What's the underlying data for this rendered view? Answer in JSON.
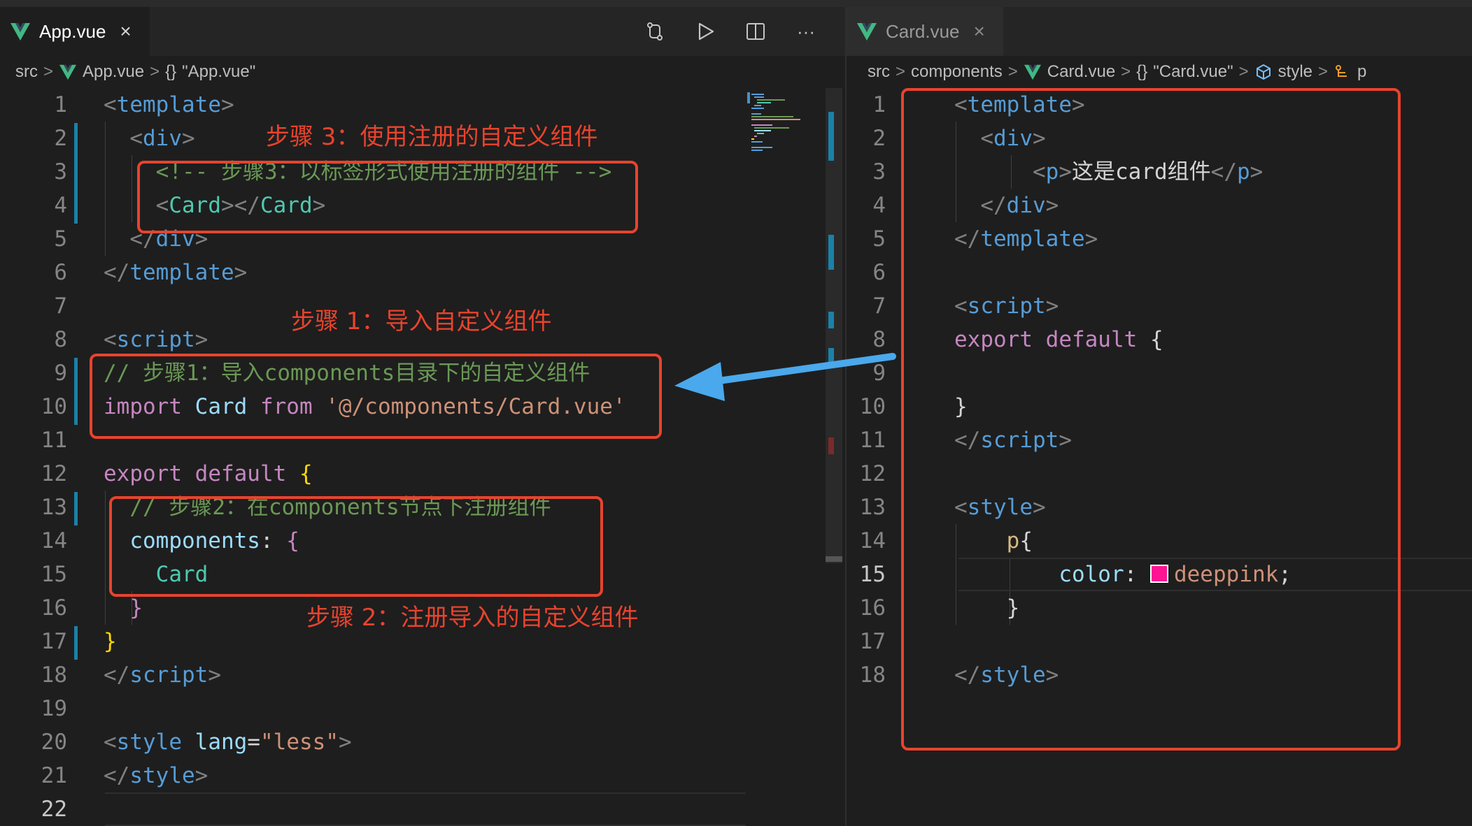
{
  "left": {
    "tab": {
      "label": "App.vue",
      "close": "×"
    },
    "actions": [
      "source-control-icon",
      "run-icon",
      "split-editor-icon",
      "more-icon"
    ],
    "more_label": "···",
    "breadcrumb": {
      "src": "src",
      "file": "App.vue",
      "symbol": "\"App.vue\"",
      "sep": ">",
      "brace": "{}"
    },
    "lines": [
      "1",
      "2",
      "3",
      "4",
      "5",
      "6",
      "7",
      "8",
      "9",
      "10",
      "11",
      "12",
      "13",
      "14",
      "15",
      "16",
      "17",
      "18",
      "19",
      "20",
      "21",
      "22"
    ],
    "code": {
      "l1": "template",
      "l2": "div",
      "l3": "<!-- 步骤3：以标签形式使用注册的组件 -->",
      "l4": "Card",
      "l5": "div",
      "l6": "template",
      "l8": "script",
      "l9": "// 步骤1：导入components目录下的自定义组件",
      "l10_kw": "import",
      "l10_name": "Card",
      "l10_from": "from",
      "l10_str": "'@/components/Card.vue'",
      "l12_export": "export",
      "l12_default": "default",
      "l13": "// 步骤2：在components节点下注册组件",
      "l14": "components",
      "l15": "Card",
      "l18": "script",
      "l20_tag": "style",
      "l20_attr": "lang",
      "l20_val": "\"less\"",
      "l21": "style"
    },
    "annotations": {
      "step3": "步骤 3：使用注册的自定义组件",
      "step1": "步骤 1：导入自定义组件",
      "step2": "步骤 2：注册导入的自定义组件"
    }
  },
  "right": {
    "tab": {
      "label": "Card.vue",
      "close": "×"
    },
    "breadcrumb": {
      "src": "src",
      "folder": "components",
      "file": "Card.vue",
      "symbol": "\"Card.vue\"",
      "style": "style",
      "p": "p",
      "sep": ">",
      "brace": "{}"
    },
    "lines": [
      "1",
      "2",
      "3",
      "4",
      "5",
      "6",
      "7",
      "8",
      "9",
      "10",
      "11",
      "12",
      "13",
      "14",
      "15",
      "16",
      "17",
      "18"
    ],
    "code": {
      "l1": "template",
      "l2": "div",
      "l3_tag": "p",
      "l3_text": "这是card组件",
      "l4": "div",
      "l5": "template",
      "l7": "script",
      "l8_export": "export",
      "l8_default": "default",
      "l11": "script",
      "l13": "style",
      "l14": "p",
      "l15_prop": "color",
      "l15_val": "deeppink",
      "l18": "style"
    }
  },
  "colors": {
    "annotation": "#e8432d",
    "arrow": "#4aa8ec",
    "swatch": "#ff1493"
  }
}
